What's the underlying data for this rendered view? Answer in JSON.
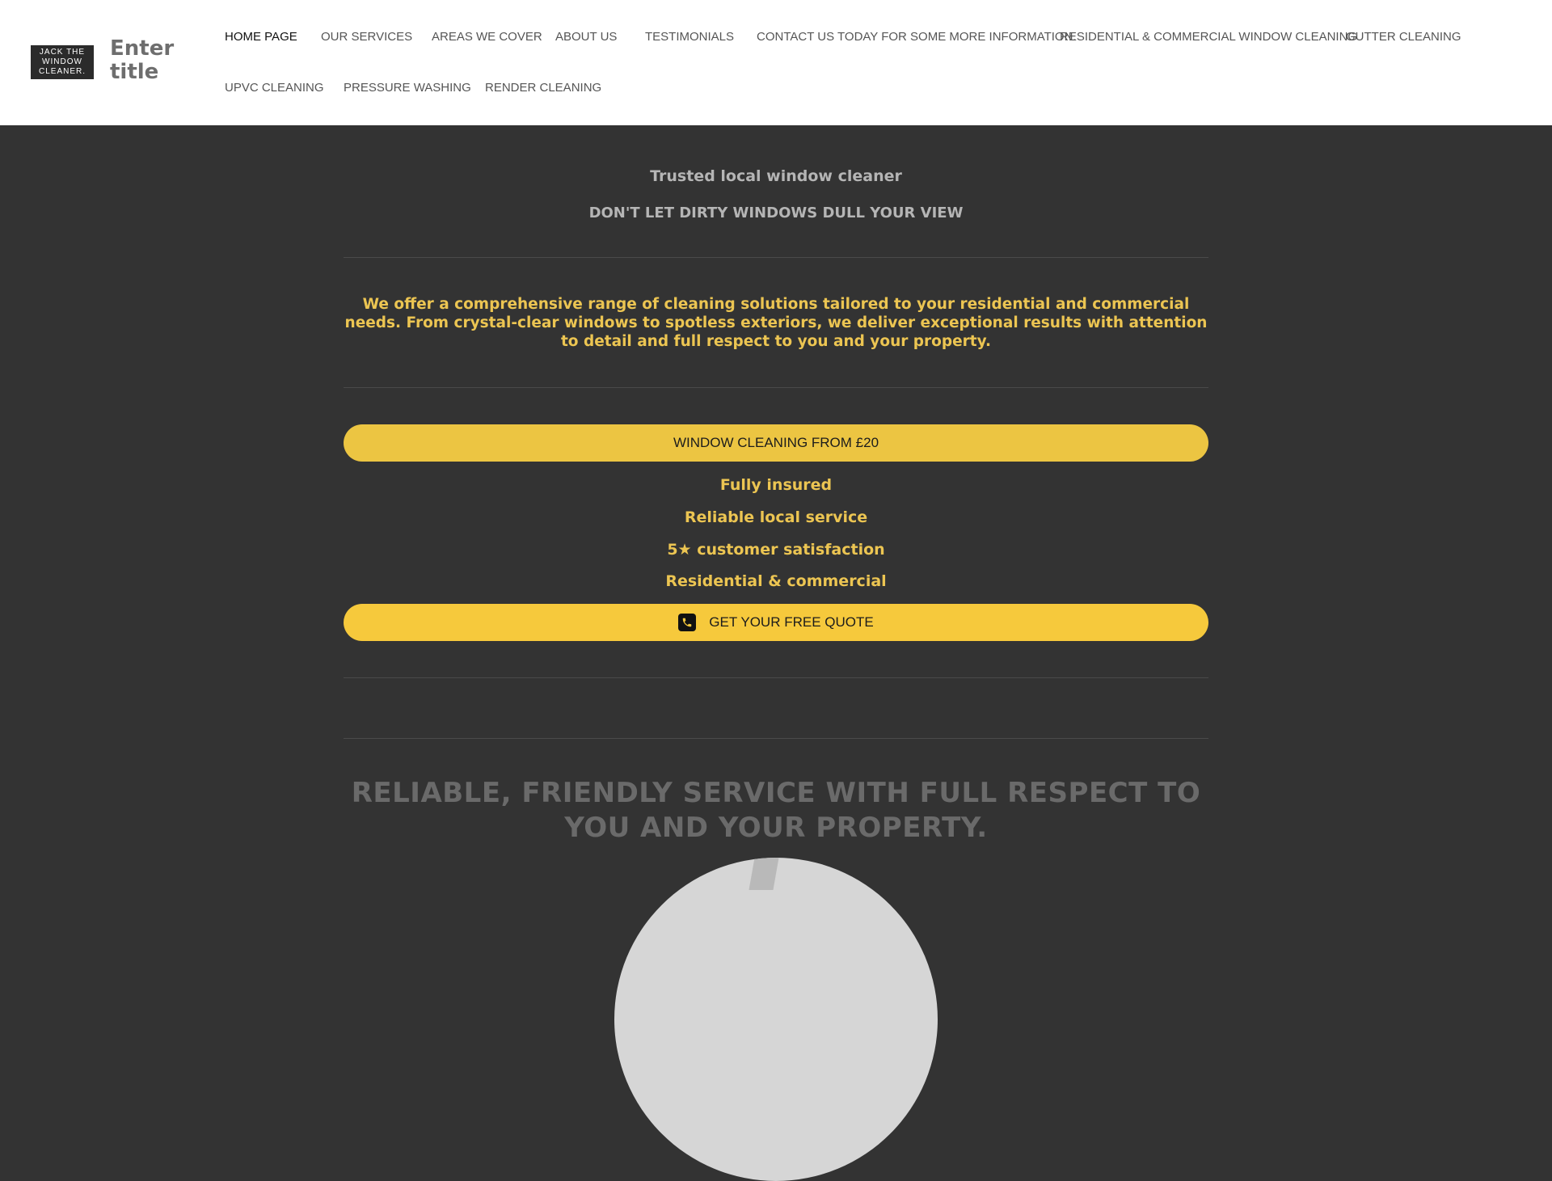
{
  "header": {
    "logo_lines": [
      "JACK THE",
      "WINDOW",
      "CLEANER."
    ],
    "site_title": "Enter title"
  },
  "nav": {
    "items": [
      {
        "label": "HOME PAGE",
        "active": true
      },
      {
        "label": "OUR SERVICES",
        "active": false
      },
      {
        "label": "AREAS WE COVER",
        "active": false
      },
      {
        "label": "ABOUT US",
        "active": false
      },
      {
        "label": "TESTIMONIALS",
        "active": false
      },
      {
        "label": "CONTACT US TODAY FOR SOME MORE INFORMATION.",
        "active": false
      },
      {
        "label": "RESIDENTIAL & COMMERCIAL WINDOW CLEANING",
        "active": false
      },
      {
        "label": "GUTTER CLEANING",
        "active": false
      },
      {
        "label": "UPVC CLEANING",
        "active": false
      },
      {
        "label": "PRESSURE WASHING",
        "active": false
      },
      {
        "label": "RENDER CLEANING",
        "active": false
      }
    ]
  },
  "hero": {
    "tagline": "Trusted local window cleaner",
    "sub_tagline": "DON'T LET DIRTY WINDOWS DULL YOUR VIEW",
    "intro": "We offer a comprehensive range of cleaning solutions tailored to your residential and commercial needs. From crystal-clear windows to spotless exteriors, we deliver exceptional results with attention to detail and full respect to you and your property.",
    "price_button": "WINDOW CLEANING FROM £20",
    "features": [
      "Fully insured",
      "Reliable local service",
      "5★ customer satisfaction",
      "Residential & commercial"
    ],
    "quote_button": "GET YOUR FREE QUOTE",
    "quote_icon": "phone-icon"
  },
  "section": {
    "headline": "RELIABLE, FRIENDLY SERVICE WITH FULL RESPECT TO YOU AND YOUR PROPERTY."
  },
  "colors": {
    "background": "#333333",
    "accent_yellow": "#f6c93c",
    "text_yellow": "#ecc552",
    "header_bg": "#ffffff"
  }
}
